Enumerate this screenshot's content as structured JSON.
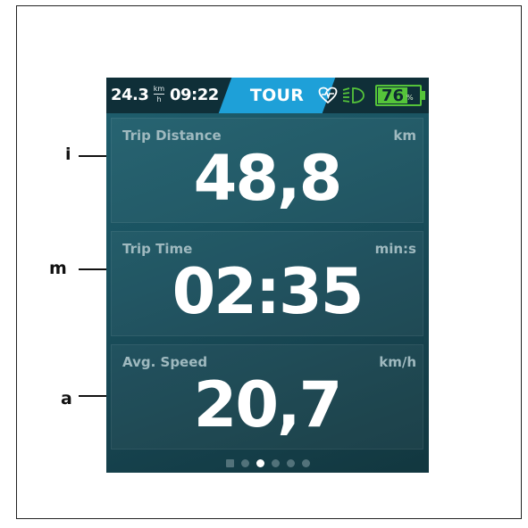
{
  "statusbar": {
    "speed": "24.3",
    "speed_unit_top": "km",
    "speed_unit_bottom": "h",
    "clock": "09:22",
    "mode": "TOUR",
    "battery_percent": 76,
    "battery_text": "76",
    "battery_unit": "%",
    "icons": [
      "heart-rate-icon",
      "headlight-icon"
    ],
    "accent_color": "#1ea0d8",
    "battery_color": "#55c43a"
  },
  "tiles": [
    {
      "label": "Trip Distance",
      "unit": "km",
      "value": "48,8"
    },
    {
      "label": "Trip Time",
      "unit": "min:s",
      "value": "02:35"
    },
    {
      "label": "Avg. Speed",
      "unit": "km/h",
      "value": "20,7"
    }
  ],
  "pager": {
    "count": 6,
    "active_index": 2
  },
  "callouts": [
    "i",
    "m",
    "a"
  ]
}
